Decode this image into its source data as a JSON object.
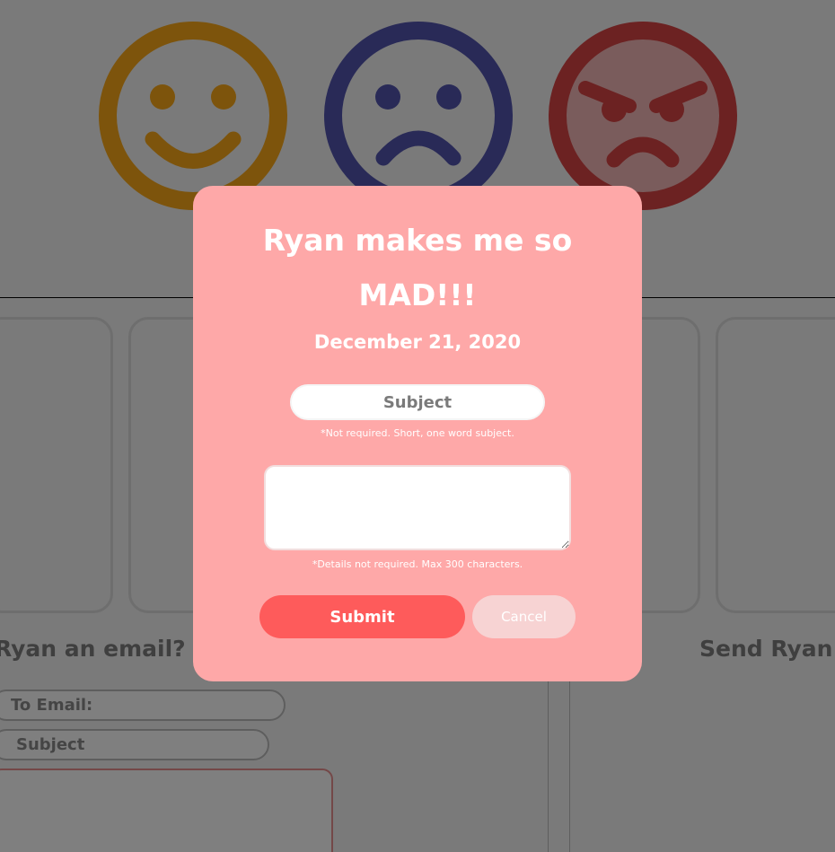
{
  "moods": [
    {
      "name": "happy",
      "icon": "smiling-face-icon",
      "color": "#fba919"
    },
    {
      "name": "sad",
      "icon": "frowning-face-icon",
      "color": "#5255ae"
    },
    {
      "name": "mad",
      "icon": "angry-face-icon",
      "color": "#d84444"
    }
  ],
  "background": {
    "email_heading": "Ryan an email?",
    "letter_heading": "Send Ryan le",
    "email_form": {
      "to_placeholder": "To Email:",
      "subject_placeholder": "Subject"
    }
  },
  "modal": {
    "title": "Ryan makes me so MAD!!!",
    "date": "December 21, 2020",
    "subject_placeholder": "Subject",
    "subject_hint": "*Not required. Short, one word subject.",
    "details_hint": "*Details not required. Max 300 characters.",
    "submit_label": "Submit",
    "cancel_label": "Cancel",
    "background_color": "#fea8a8",
    "submit_color": "#fe5b5b"
  }
}
